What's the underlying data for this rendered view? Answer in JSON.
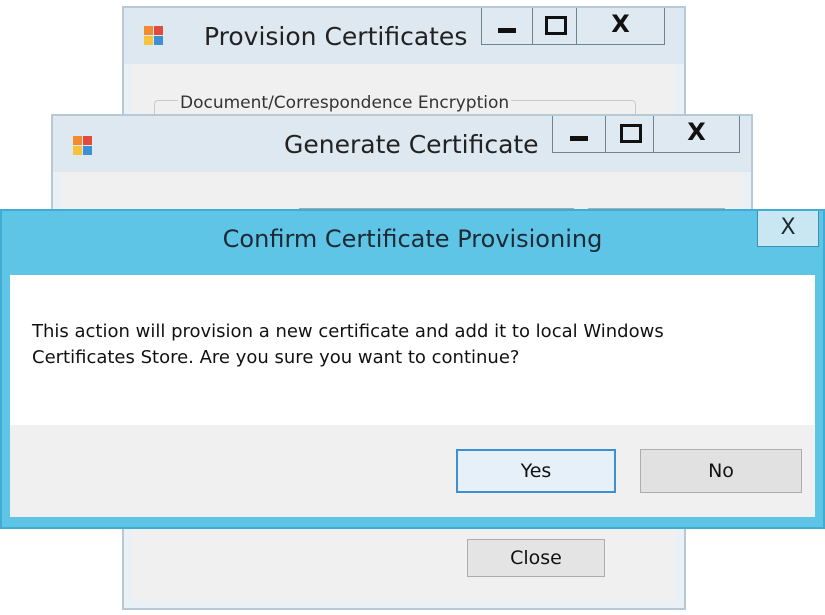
{
  "provision_window": {
    "title": "Provision Certificates",
    "group_label": "Document/Correspondence Encryption",
    "close_button": "Close",
    "controls": {
      "minimize": "minimize-icon",
      "maximize": "maximize-icon",
      "close": "X"
    }
  },
  "generate_window": {
    "title": "Generate Certificate",
    "controls": {
      "minimize": "minimize-icon",
      "maximize": "maximize-icon",
      "close": "X"
    }
  },
  "confirm_dialog": {
    "title": "Confirm Certificate Provisioning",
    "close": "X",
    "message": "This action will provision a new certificate and add it to local Windows Certificates Store. Are you sure you want to continue?",
    "yes_label": "Yes",
    "no_label": "No"
  },
  "colors": {
    "dialog_title_bar": "#5ec5e7",
    "default_button_border": "#3c8fd0",
    "app_icon": [
      "#f28b2e",
      "#e14b3b",
      "#f6c33b",
      "#3d8fd6"
    ]
  }
}
